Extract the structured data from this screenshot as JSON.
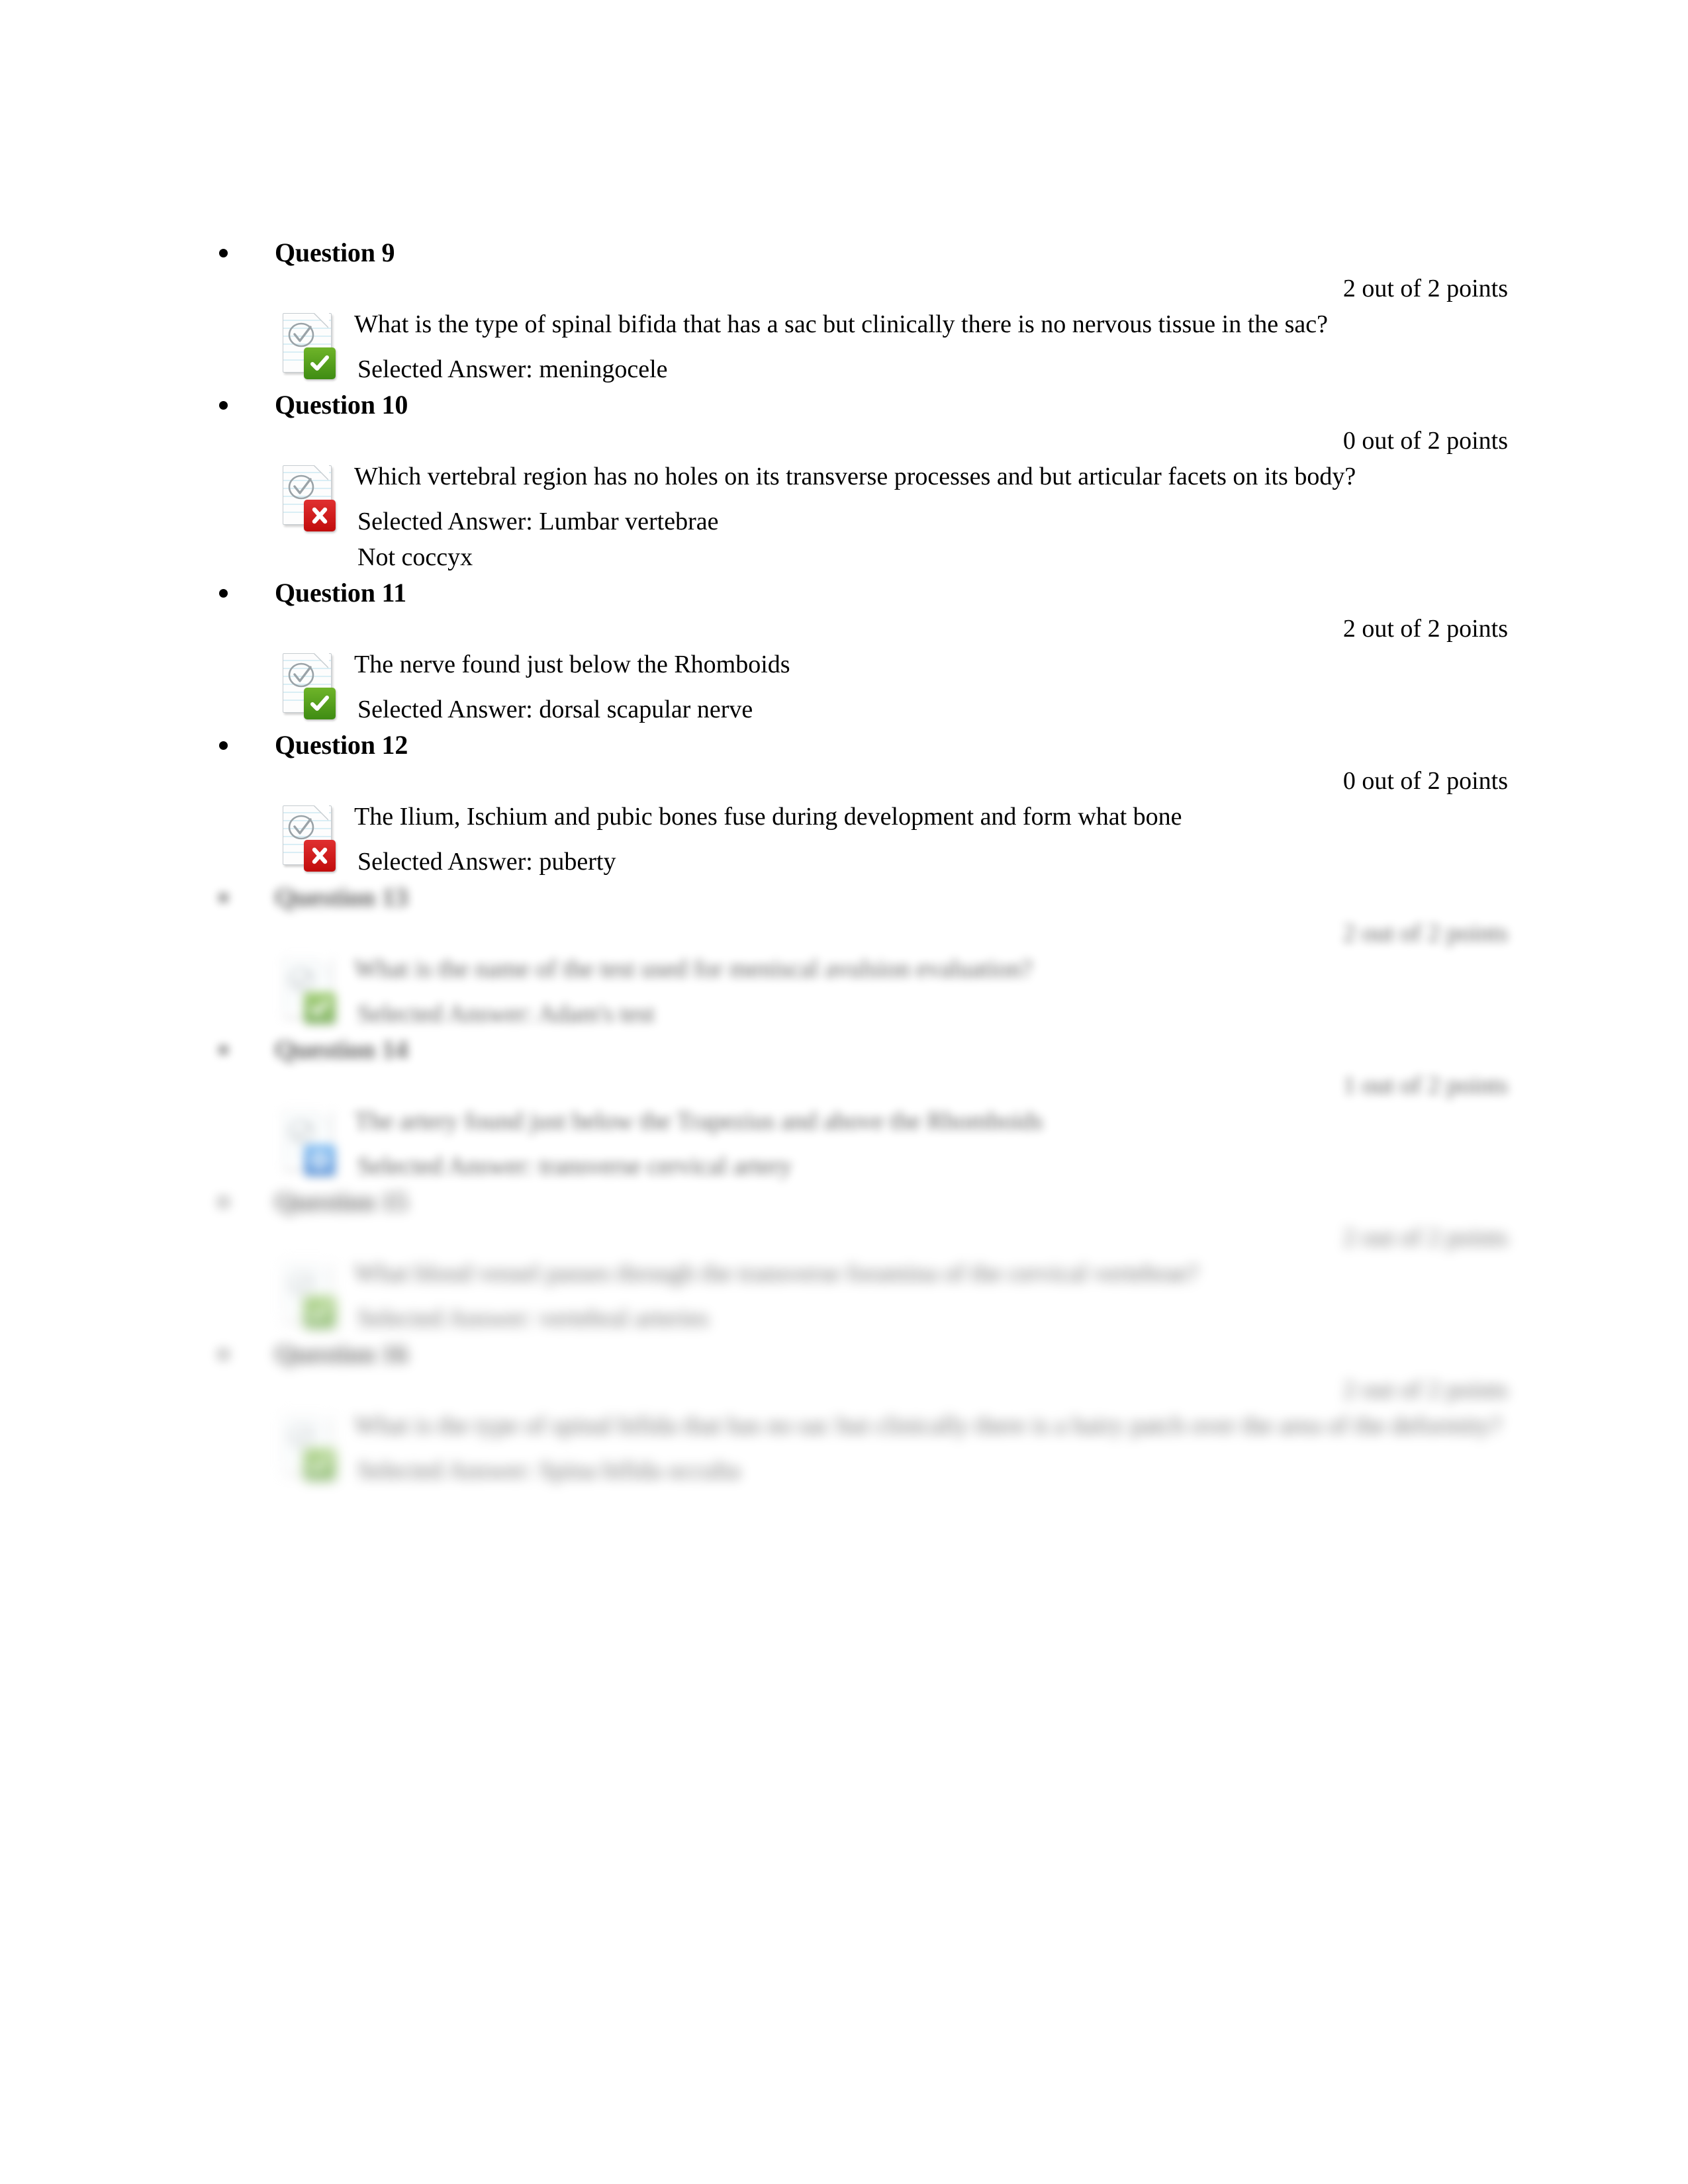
{
  "document": {
    "type": "exam-results-review",
    "page_background": "#ffffff"
  },
  "colors": {
    "correct_badge": "#4f9b16",
    "incorrect_badge": "#d01414",
    "partial_badge": "#2b82e0",
    "text": "#000000",
    "sheet_line": "#d9eef5"
  },
  "icons": {
    "correct": "check-mark-icon",
    "incorrect": "x-mark-icon",
    "partial": "partial-credit-icon",
    "sheet": "quiz-sheet-icon",
    "bullet": "bullet-point-icon"
  },
  "questions": [
    {
      "label": "Question 9",
      "points": "2 out of 2 points",
      "status": "correct",
      "text": "What is the type of spinal bifida that has a sac but clinically there is no nervous tissue in the sac?",
      "selected_answer": "Selected Answer: meningocele",
      "extra": "",
      "blurred": false
    },
    {
      "label": "Question 10",
      "points": "0 out of 2 points",
      "status": "incorrect",
      "text": "Which vertebral region has no holes on its transverse processes and but articular facets on its body?",
      "selected_answer": "Selected Answer: Lumbar vertebrae",
      "extra": "Not coccyx",
      "blurred": false
    },
    {
      "label": "Question 11",
      "points": "2 out of 2 points",
      "status": "correct",
      "text": "The nerve found just below the Rhomboids",
      "selected_answer": "Selected Answer: dorsal scapular nerve",
      "extra": "",
      "blurred": false
    },
    {
      "label": "Question 12",
      "points": "0 out of 2 points",
      "status": "incorrect",
      "text": "The Ilium, Ischium and pubic bones fuse during development and form what bone",
      "selected_answer": "Selected Answer: puberty",
      "extra": "",
      "blurred": false
    },
    {
      "label": "Question 13",
      "points": "2 out of 2 points",
      "status": "correct",
      "text": "What is the name of the test used for meniscal avulsion evaluation?",
      "selected_answer": "Selected Answer: Adam's test",
      "extra": "",
      "blurred": true
    },
    {
      "label": "Question 14",
      "points": "1 out of 2 points",
      "status": "partial",
      "text": "The artery found just below the Trapezius and above the Rhomboids",
      "selected_answer": "Selected Answer: transverse cervical artery",
      "extra": "",
      "blurred": true
    },
    {
      "label": "Question 15",
      "points": "2 out of 2 points",
      "status": "correct",
      "text": "What blood vessel passes through the transverse foramina of the cervical vertebrae?",
      "selected_answer": "Selected Answer: vertebral arteries",
      "extra": "",
      "blurred": true
    },
    {
      "label": "Question 16",
      "points": "2 out of 2 points",
      "status": "correct",
      "text": "What is the type of spinal bifida that has no sac but clinically there is a hairy patch over the area of the deformity?",
      "selected_answer": "Selected Answer: Spina bifida occulta",
      "extra": "",
      "blurred": true
    }
  ]
}
